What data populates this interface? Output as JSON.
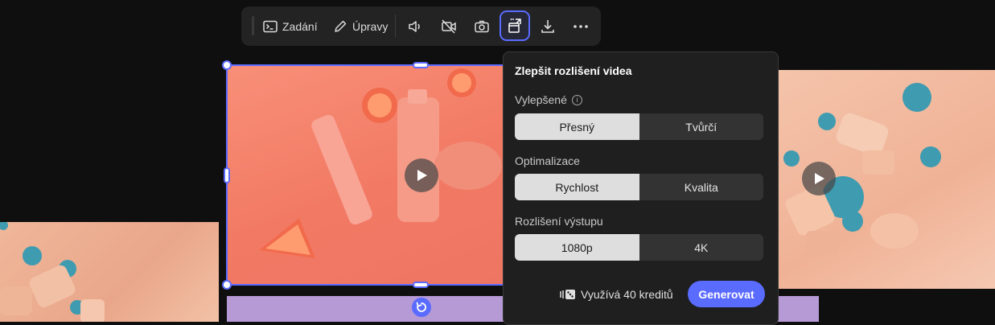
{
  "toolbar": {
    "prompt_label": "Zadání",
    "edits_label": "Úpravy",
    "icons": [
      "terminal-icon",
      "pencil-icon",
      "audio-icon",
      "camera-off-icon",
      "camera-icon",
      "upscale-icon",
      "download-icon",
      "more-icon"
    ]
  },
  "panel": {
    "title": "Zlepšit rozlišení videa",
    "enhanced": {
      "label": "Vylepšené",
      "options": [
        "Přesný",
        "Tvůrčí"
      ],
      "selected": "Přesný"
    },
    "optimization": {
      "label": "Optimalizace",
      "options": [
        "Rychlost",
        "Kvalita"
      ],
      "selected": "Rychlost"
    },
    "resolution": {
      "label": "Rozlišení výstupu",
      "options": [
        "1080p",
        "4K"
      ],
      "selected": "1080p"
    },
    "credits_text": "Využívá 40 kreditů",
    "generate_label": "Generovat"
  },
  "colors": {
    "accent": "#5a6bff",
    "panel_bg": "#1f1f1f",
    "toolbar_bg": "#232323"
  }
}
